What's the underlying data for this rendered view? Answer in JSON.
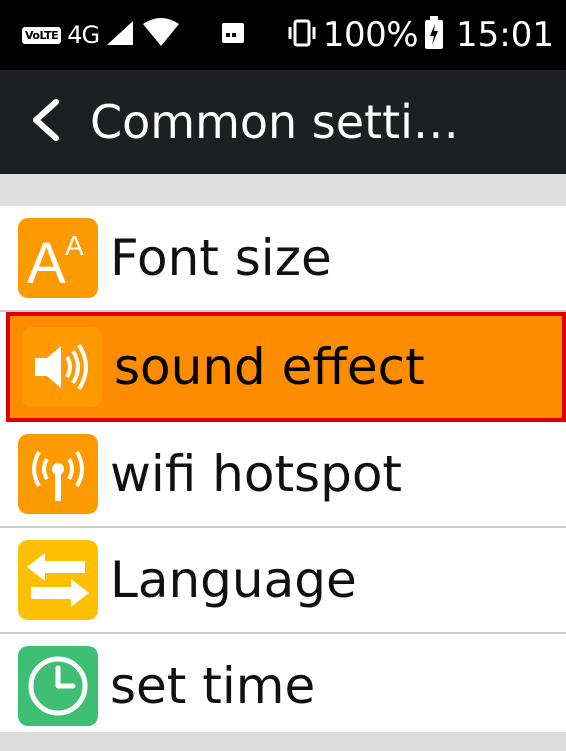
{
  "status_bar": {
    "volte": "VoLTE",
    "network": "4G",
    "battery_percent": "100%",
    "time": "15:01",
    "icons": [
      "signal-icon",
      "wifi-icon",
      "notification-icon",
      "vibrate-icon",
      "battery-icon"
    ]
  },
  "header": {
    "title": "Common setti…",
    "back_icon": "chevron-left-icon"
  },
  "menu": {
    "items": [
      {
        "label": "Font size",
        "icon": "font-size-icon",
        "color": "#fd9a00"
      },
      {
        "label": "sound effect",
        "icon": "speaker-icon",
        "color": "#fd8c00",
        "selected": true
      },
      {
        "label": "wifi hotspot",
        "icon": "hotspot-icon",
        "color": "#fd9a00"
      },
      {
        "label": "Language",
        "icon": "swap-arrows-icon",
        "color": "#fdbf00"
      },
      {
        "label": "set time",
        "icon": "clock-icon",
        "color": "#3fbf73"
      }
    ]
  },
  "colors": {
    "status_bar_bg": "#000000",
    "title_bar_bg": "#1d1f21",
    "selection_fill": "#fd8c00",
    "selection_border": "#e00000"
  }
}
